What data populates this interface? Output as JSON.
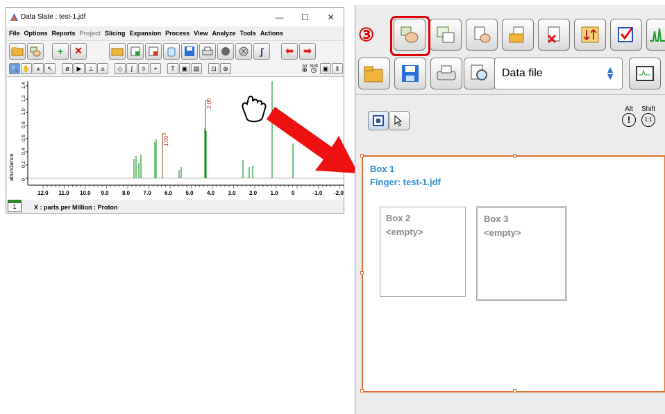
{
  "window": {
    "title": "Data Slate : test-1.jdf",
    "min": "—",
    "max": "☐",
    "close": "✕"
  },
  "menu": [
    {
      "label": "File",
      "enabled": true
    },
    {
      "label": "Options",
      "enabled": true
    },
    {
      "label": "Reports",
      "enabled": true
    },
    {
      "label": "Project",
      "enabled": false
    },
    {
      "label": "Slicing",
      "enabled": true
    },
    {
      "label": "Expansion",
      "enabled": true
    },
    {
      "label": "Process",
      "enabled": true
    },
    {
      "label": "View",
      "enabled": true
    },
    {
      "label": "Analyze",
      "enabled": true
    },
    {
      "label": "Tools",
      "enabled": true
    },
    {
      "label": "Actions",
      "enabled": true
    }
  ],
  "toolbar1": {
    "add": "+",
    "delete": "✕"
  },
  "toolbar2": {
    "alt": "Alt",
    "shift": "Shift"
  },
  "spectrum": {
    "ylabel": "abundance",
    "yticks": [
      "0",
      "0.2",
      "0.4",
      "0.6",
      "0.8",
      "1.0",
      "1.2",
      "1.4"
    ],
    "xticks": [
      "12.0",
      "11.0",
      "10.0",
      "9.0",
      "8.0",
      "7.0",
      "6.0",
      "5.0",
      "4.0",
      "3.0",
      "2.0",
      "1.0",
      "0",
      "-1.0",
      "-2.0"
    ],
    "integrals": [
      "1.00",
      "2.00"
    ],
    "xaxis_title": "X : parts per Million : Proton",
    "page": "1"
  },
  "step_marker": "③",
  "datafile_select": "Data file",
  "alt_label": "Alt",
  "shift_label": "Shift",
  "alt_symbol": "!",
  "shift_symbol": "1:1",
  "box1": {
    "title": "Box 1",
    "content": "Finger: test-1.jdf"
  },
  "box2": {
    "title": "Box 2",
    "content": "<empty>"
  },
  "box3": {
    "title": "Box 3",
    "content": "<empty>"
  }
}
